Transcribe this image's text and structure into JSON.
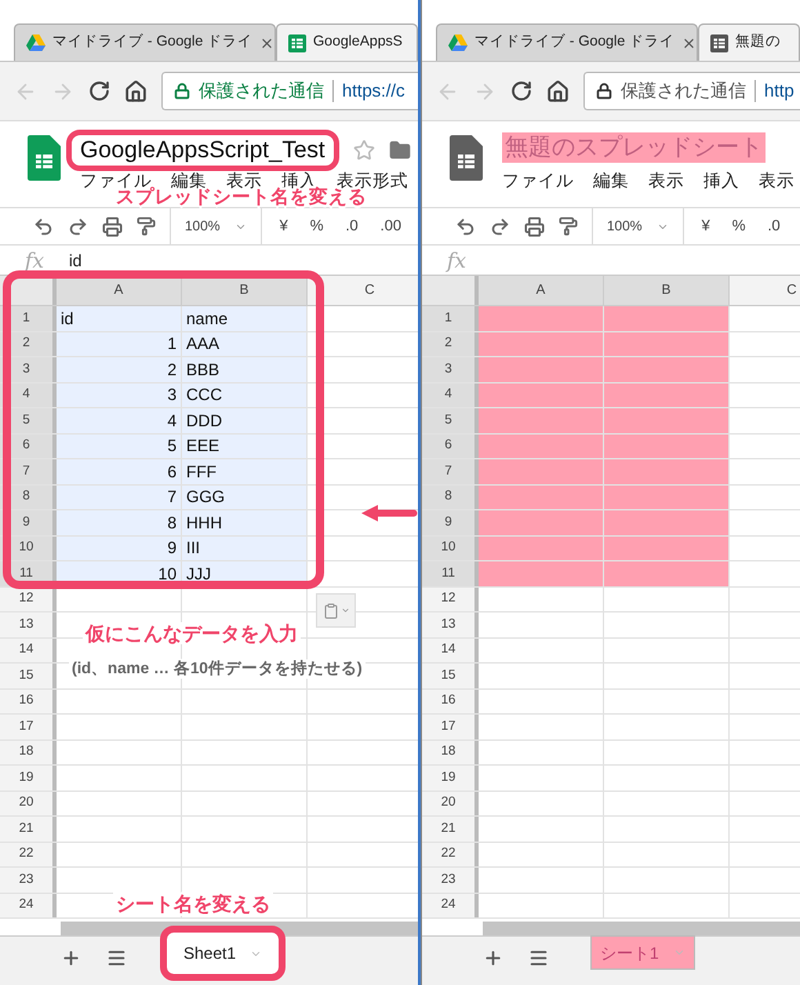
{
  "windows": [
    {
      "tabs": [
        {
          "label": "マイドライブ - Google ドライ",
          "selected": false
        },
        {
          "label": "GoogleAppsS",
          "selected": true
        }
      ],
      "address": {
        "secure_label": "保護された通信",
        "secure": true,
        "url": "https://c"
      },
      "doc": {
        "title": "GoogleAppsScript_Test",
        "title_callout": "スプレッドシート名を変える",
        "menu": [
          "ファイル",
          "編集",
          "表示",
          "挿入",
          "表示形式"
        ]
      },
      "toolbar": {
        "zoom": "100%",
        "items": [
          "¥",
          "%",
          ".0",
          ".00"
        ]
      },
      "formula": {
        "fx": "fx",
        "value": "id"
      },
      "columns": [
        "A",
        "B",
        "C"
      ],
      "rows": [
        {
          "header": "1",
          "selected": true,
          "cells": [
            {
              "value": "id",
              "kind": "text"
            },
            {
              "value": "name",
              "kind": "text"
            }
          ]
        },
        {
          "header": "2",
          "selected": true,
          "cells": [
            {
              "value": "1",
              "kind": "number"
            },
            {
              "value": "AAA",
              "kind": "text"
            }
          ]
        },
        {
          "header": "3",
          "selected": true,
          "cells": [
            {
              "value": "2",
              "kind": "number"
            },
            {
              "value": "BBB",
              "kind": "text"
            }
          ]
        },
        {
          "header": "4",
          "selected": true,
          "cells": [
            {
              "value": "3",
              "kind": "number"
            },
            {
              "value": "CCC",
              "kind": "text"
            }
          ]
        },
        {
          "header": "5",
          "selected": true,
          "cells": [
            {
              "value": "4",
              "kind": "number"
            },
            {
              "value": "DDD",
              "kind": "text"
            }
          ]
        },
        {
          "header": "6",
          "selected": true,
          "cells": [
            {
              "value": "5",
              "kind": "number"
            },
            {
              "value": "EEE",
              "kind": "text"
            }
          ]
        },
        {
          "header": "7",
          "selected": true,
          "cells": [
            {
              "value": "6",
              "kind": "number"
            },
            {
              "value": "FFF",
              "kind": "text"
            }
          ]
        },
        {
          "header": "8",
          "selected": true,
          "cells": [
            {
              "value": "7",
              "kind": "number"
            },
            {
              "value": "GGG",
              "kind": "text"
            }
          ]
        },
        {
          "header": "9",
          "selected": true,
          "cells": [
            {
              "value": "8",
              "kind": "number"
            },
            {
              "value": "HHH",
              "kind": "text"
            }
          ]
        },
        {
          "header": "10",
          "selected": true,
          "cells": [
            {
              "value": "9",
              "kind": "number"
            },
            {
              "value": "III",
              "kind": "text"
            }
          ]
        },
        {
          "header": "11",
          "selected": true,
          "cells": [
            {
              "value": "10",
              "kind": "number"
            },
            {
              "value": "JJJ",
              "kind": "text"
            }
          ]
        },
        {
          "header": "12",
          "selected": false
        },
        {
          "header": "13",
          "selected": false
        },
        {
          "header": "14",
          "selected": false
        },
        {
          "header": "15",
          "selected": false
        },
        {
          "header": "16",
          "selected": false
        },
        {
          "header": "17",
          "selected": false
        },
        {
          "header": "18",
          "selected": false
        },
        {
          "header": "19",
          "selected": false
        },
        {
          "header": "20",
          "selected": false
        },
        {
          "header": "21",
          "selected": false
        },
        {
          "header": "22",
          "selected": false
        },
        {
          "header": "23",
          "selected": false
        },
        {
          "header": "24",
          "selected": false
        }
      ],
      "grid_callout": "仮にこんなデータを入力",
      "grid_note": "(id、name … 各10件データを持たせる)",
      "sheet_tab": {
        "label": "Sheet1",
        "callout": "シート名を変える"
      }
    },
    {
      "tabs": [
        {
          "label": "マイドライブ - Google ドライ",
          "selected": false
        },
        {
          "label": "無題の",
          "selected": true
        }
      ],
      "address": {
        "secure_label": "保護された通信",
        "secure": false,
        "url": "http"
      },
      "doc": {
        "title": "無題のスプレッドシート",
        "menu": [
          "ファイル",
          "編集",
          "表示",
          "挿入",
          "表示"
        ]
      },
      "toolbar": {
        "zoom": "100%",
        "items": [
          "¥",
          "%",
          ".0"
        ]
      },
      "formula": {
        "fx": "fx"
      },
      "columns": [
        "A",
        "B",
        "C"
      ],
      "rows": [
        {
          "header": "1",
          "selected": true
        },
        {
          "header": "2",
          "selected": true
        },
        {
          "header": "3",
          "selected": true
        },
        {
          "header": "4",
          "selected": true
        },
        {
          "header": "5",
          "selected": true
        },
        {
          "header": "6",
          "selected": true
        },
        {
          "header": "7",
          "selected": true
        },
        {
          "header": "8",
          "selected": true
        },
        {
          "header": "9",
          "selected": true
        },
        {
          "header": "10",
          "selected": true
        },
        {
          "header": "11",
          "selected": true
        },
        {
          "header": "12",
          "selected": false
        },
        {
          "header": "13",
          "selected": false
        },
        {
          "header": "14",
          "selected": false
        },
        {
          "header": "15",
          "selected": false
        },
        {
          "header": "16",
          "selected": false
        },
        {
          "header": "17",
          "selected": false
        },
        {
          "header": "18",
          "selected": false
        },
        {
          "header": "19",
          "selected": false
        },
        {
          "header": "20",
          "selected": false
        },
        {
          "header": "21",
          "selected": false
        },
        {
          "header": "22",
          "selected": false
        },
        {
          "header": "23",
          "selected": false
        },
        {
          "header": "24",
          "selected": false
        }
      ],
      "sheet_tab": {
        "label": "シート1"
      }
    }
  ]
}
